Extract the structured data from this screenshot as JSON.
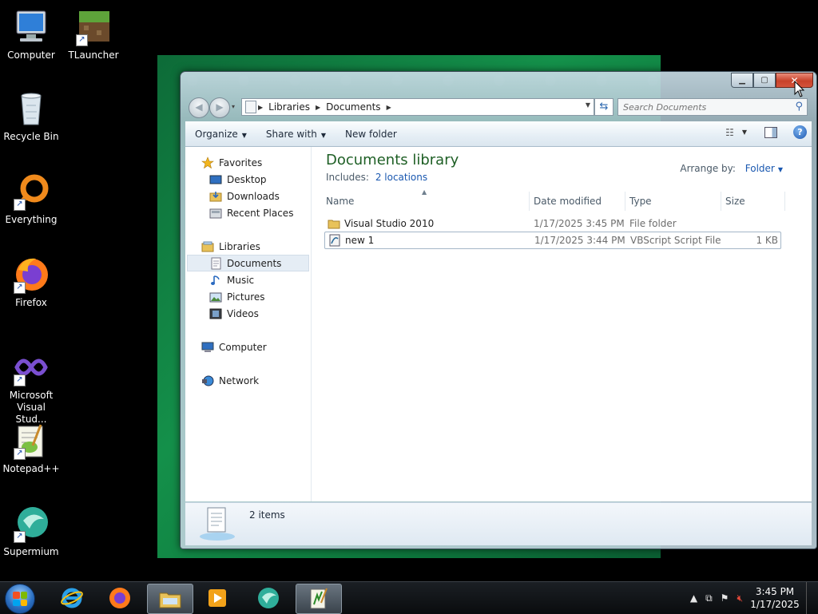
{
  "desktop": {
    "icons": [
      {
        "label": "Computer"
      },
      {
        "label": "TLauncher"
      },
      {
        "label": "Recycle Bin"
      },
      {
        "label": "Everything"
      },
      {
        "label": "Firefox"
      },
      {
        "label": "Microsoft Visual Stud..."
      },
      {
        "label": "Notepad++"
      },
      {
        "label": "Supermium"
      }
    ]
  },
  "window": {
    "address": {
      "crumbs": [
        "Libraries",
        "Documents"
      ]
    },
    "search": {
      "placeholder": "Search Documents"
    },
    "toolbar": {
      "organize": "Organize",
      "share_with": "Share with",
      "new_folder": "New folder"
    },
    "nav": {
      "favorites": "Favorites",
      "desktop": "Desktop",
      "downloads": "Downloads",
      "recent_places": "Recent Places",
      "libraries": "Libraries",
      "documents": "Documents",
      "music": "Music",
      "pictures": "Pictures",
      "videos": "Videos",
      "computer": "Computer",
      "network": "Network"
    },
    "library": {
      "title": "Documents library",
      "includes_label": "Includes:",
      "includes_link": "2 locations",
      "arrange_label": "Arrange by:",
      "arrange_value": "Folder"
    },
    "columns": {
      "name": "Name",
      "date": "Date modified",
      "type": "Type",
      "size": "Size"
    },
    "files": [
      {
        "name": "Visual Studio 2010",
        "date": "1/17/2025 3:45 PM",
        "type": "File folder",
        "size": ""
      },
      {
        "name": "new 1",
        "date": "1/17/2025 3:44 PM",
        "type": "VBScript Script File",
        "size": "1 KB"
      }
    ],
    "status": {
      "count": "2 items"
    }
  },
  "taskbar": {
    "clock_time": "3:45 PM",
    "clock_date": "1/17/2025"
  },
  "colors": {
    "library_title": "#1e5f25",
    "link": "#1a58b0",
    "close_button": "#c8422a",
    "wallpaper": "#14904a"
  }
}
